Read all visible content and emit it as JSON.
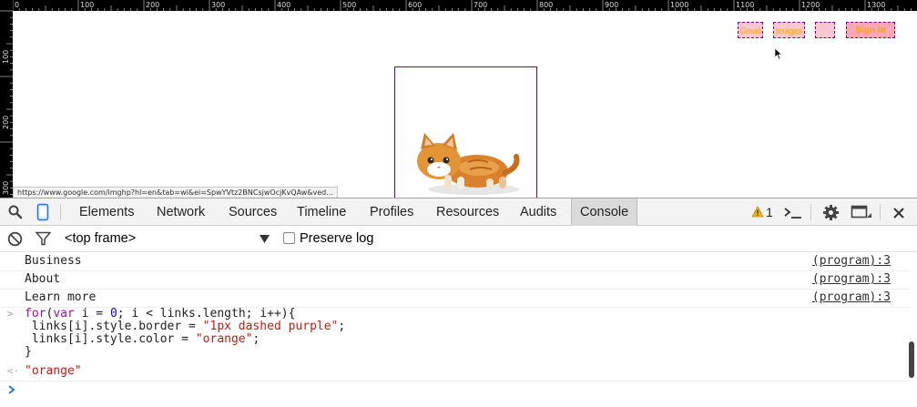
{
  "ruler": {
    "top_labels": [
      "0",
      "100",
      "200",
      "300",
      "400",
      "500",
      "600",
      "700",
      "800",
      "900",
      "1000",
      "1100",
      "1200",
      "1300"
    ],
    "left_labels": [
      "100",
      "200",
      "300"
    ]
  },
  "page": {
    "header_links": [
      "Gmail",
      "Images",
      "",
      "Sign in"
    ],
    "status_url": "https://www.google.com/imghp?hl=en&tab=wi&ei=SpwYVtz2BNCsjwOcjKvQAw&ved..."
  },
  "devtools": {
    "tabs": [
      "Elements",
      "Network",
      "Sources",
      "Timeline",
      "Profiles",
      "Resources",
      "Audits",
      "Console"
    ],
    "active_tab": "Console",
    "warning_count": "1",
    "frame_select": "<top frame>",
    "preserve_log_label": "Preserve log",
    "console_rows": [
      {
        "msg": "Business",
        "src": "(program):3"
      },
      {
        "msg": "About",
        "src": "(program):3"
      },
      {
        "msg": "Learn more",
        "src": "(program):3"
      }
    ],
    "code": {
      "line1_kw": "for",
      "line1_a": "(",
      "line1_var": "var",
      "line1_b": " i = ",
      "line1_num": "0",
      "line1_c": "; i < links.length; i++){",
      "line2_a": " links[i].style.border = ",
      "line2_str": "\"1px dashed purple\"",
      "line2_b": ";",
      "line3_a": " links[i].style.color = ",
      "line3_str": "\"orange\"",
      "line3_b": ";",
      "line4": "}"
    },
    "result": "\"orange\""
  }
}
